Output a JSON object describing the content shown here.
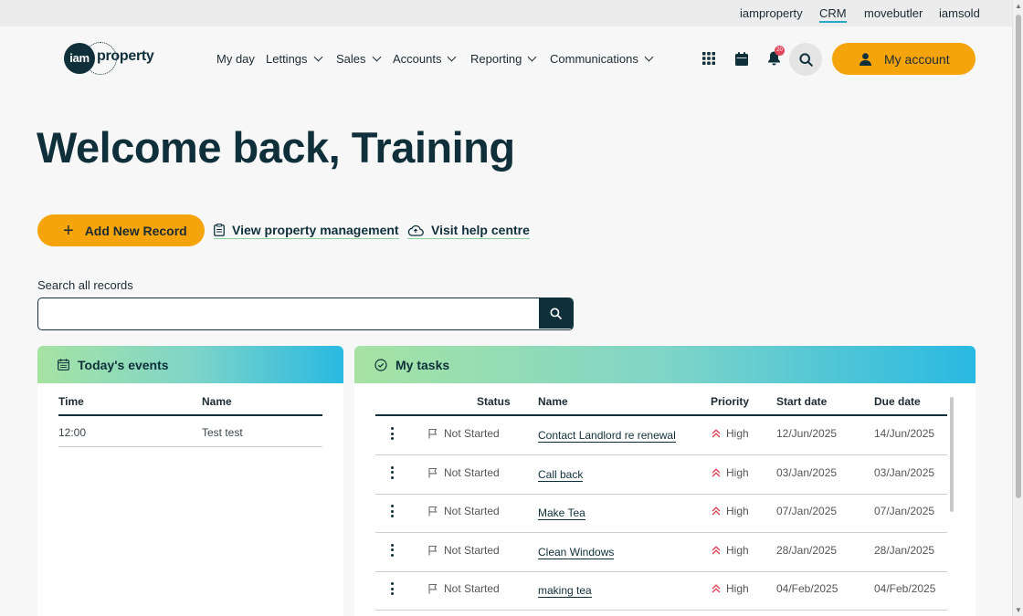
{
  "topbar": {
    "links": [
      "iamproperty",
      "CRM",
      "movebutler",
      "iamsold"
    ],
    "active": "CRM"
  },
  "logo": {
    "mark": "iam",
    "word": "property"
  },
  "nav": [
    {
      "label": "My day"
    },
    {
      "label": "Lettings"
    },
    {
      "label": "Sales"
    },
    {
      "label": "Accounts"
    },
    {
      "label": "Reporting"
    },
    {
      "label": "Communications"
    }
  ],
  "header_icons": [
    "apps-grid-icon",
    "calendar-icon",
    "bell-icon",
    "search-icon"
  ],
  "notifications": {
    "count": "20"
  },
  "account": {
    "label": "My account"
  },
  "welcome": "Welcome back, Training",
  "actions": {
    "add": "Add New Record",
    "view_pm": "View property management",
    "help": "Visit help centre"
  },
  "search": {
    "label": "Search all records",
    "value": ""
  },
  "events": {
    "title": "Today's events",
    "columns": [
      "Time",
      "Name"
    ],
    "rows": [
      {
        "time": "12:00",
        "name": "Test test"
      }
    ]
  },
  "tasks": {
    "title": "My tasks",
    "columns": [
      "Status",
      "Name",
      "Priority",
      "Start date",
      "Due date"
    ],
    "rows": [
      {
        "status": "Not Started",
        "name": "Contact Landlord re renewal",
        "priority": "High",
        "start": "12/Jun/2025",
        "due": "14/Jun/2025"
      },
      {
        "status": "Not Started",
        "name": "Call back",
        "priority": "High",
        "start": "03/Jan/2025",
        "due": "03/Jan/2025"
      },
      {
        "status": "Not Started",
        "name": "Make Tea",
        "priority": "High",
        "start": "07/Jan/2025",
        "due": "07/Jan/2025"
      },
      {
        "status": "Not Started",
        "name": "Clean Windows",
        "priority": "High",
        "start": "28/Jan/2025",
        "due": "28/Jan/2025"
      },
      {
        "status": "Not Started",
        "name": "making tea",
        "priority": "High",
        "start": "04/Feb/2025",
        "due": "04/Feb/2025"
      }
    ]
  },
  "colors": {
    "brand_orange": "#f5a50b",
    "navy": "#0f2f3a",
    "priority_high": "#e0455a"
  }
}
